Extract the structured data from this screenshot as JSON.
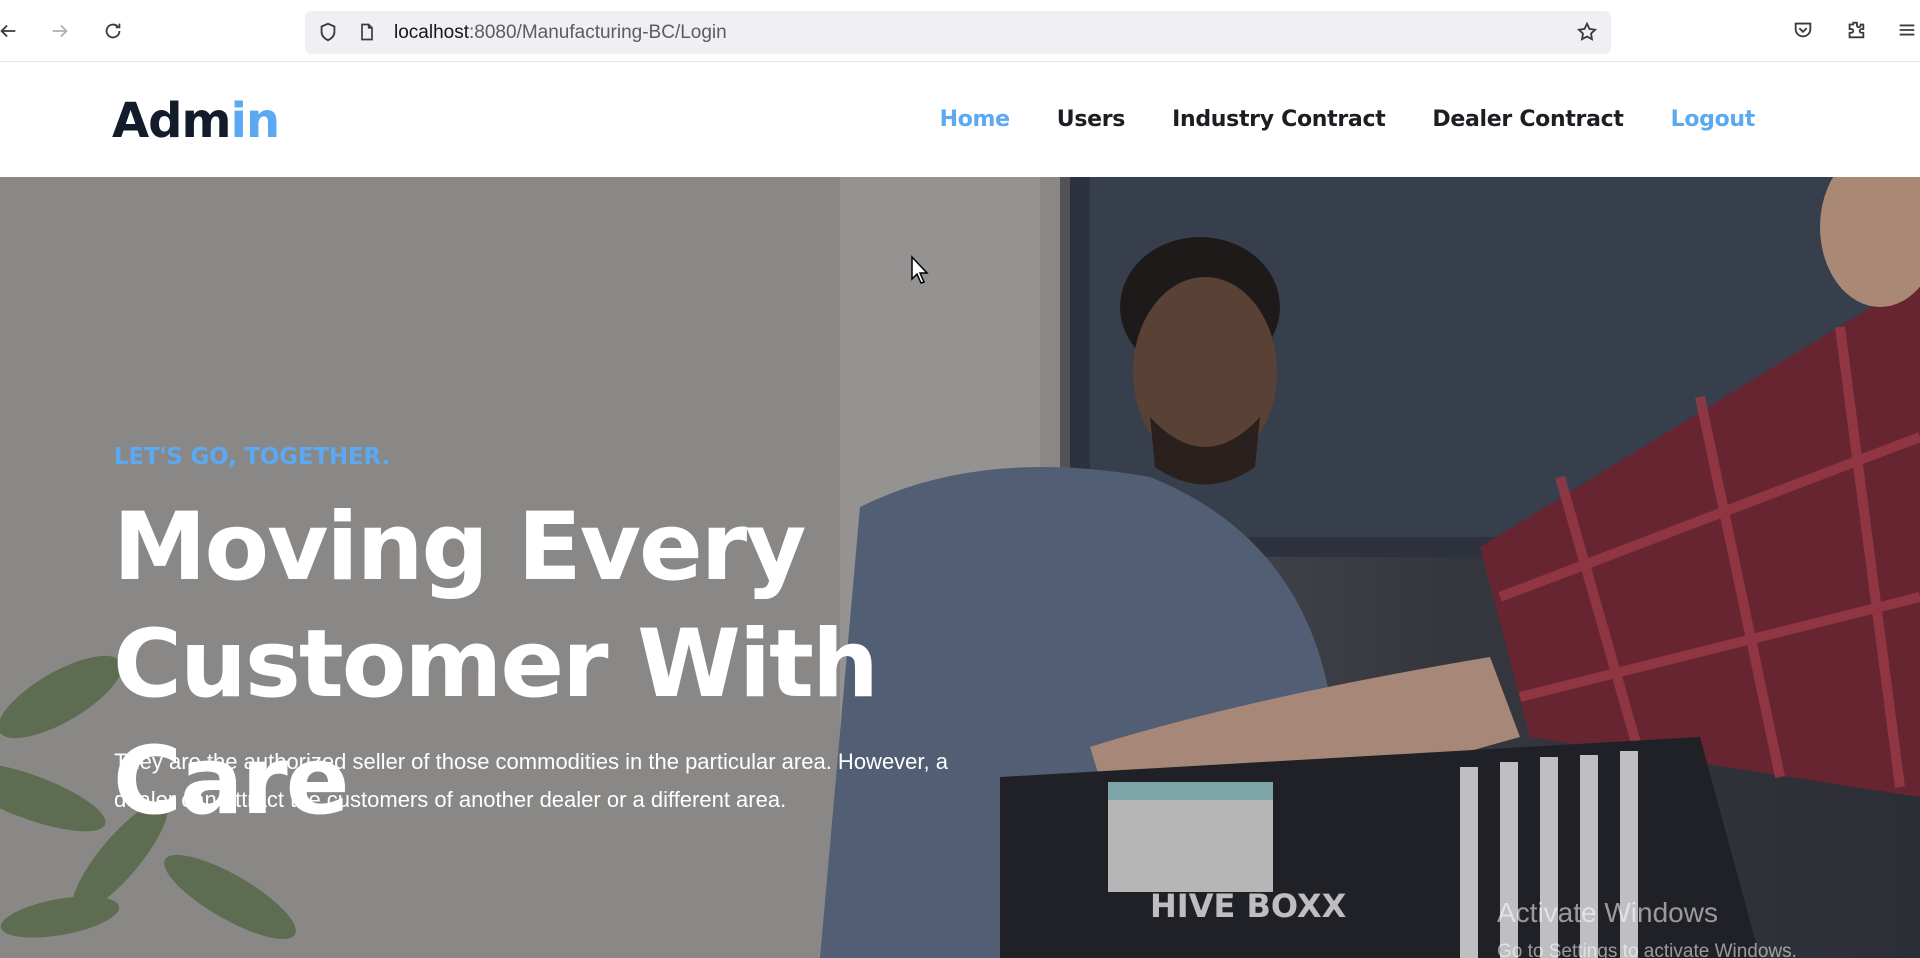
{
  "browser": {
    "url_host": "localhost",
    "url_path": ":8080/Manufacturing-BC/Login",
    "icons": [
      "back-arrow-icon",
      "forward-arrow-icon",
      "reload-icon",
      "shield-icon",
      "page-icon",
      "star-icon",
      "pocket-icon",
      "extensions-icon",
      "menu-icon"
    ]
  },
  "header": {
    "logo_main": "Adm",
    "logo_accent": "in",
    "nav": {
      "home": "Home",
      "users": "Users",
      "industry_contract": "Industry Contract",
      "dealer_contract": "Dealer Contract",
      "logout": "Logout"
    }
  },
  "hero": {
    "kicker": "LET'S GO, TOGETHER.",
    "title_line1": "Moving Every",
    "title_line2": "Customer With Care",
    "description": "They are the authorized seller of those commodities in the particular area. However, a dealer can attract the customers of another dealer or a different area.",
    "box_label": "HIVE BOXX"
  },
  "watermark": {
    "title": "Activate Windows",
    "subtitle": "Go to Settings to activate Windows."
  },
  "colors": {
    "accent": "#5aa9f2",
    "text_dark": "#1c1e22"
  }
}
